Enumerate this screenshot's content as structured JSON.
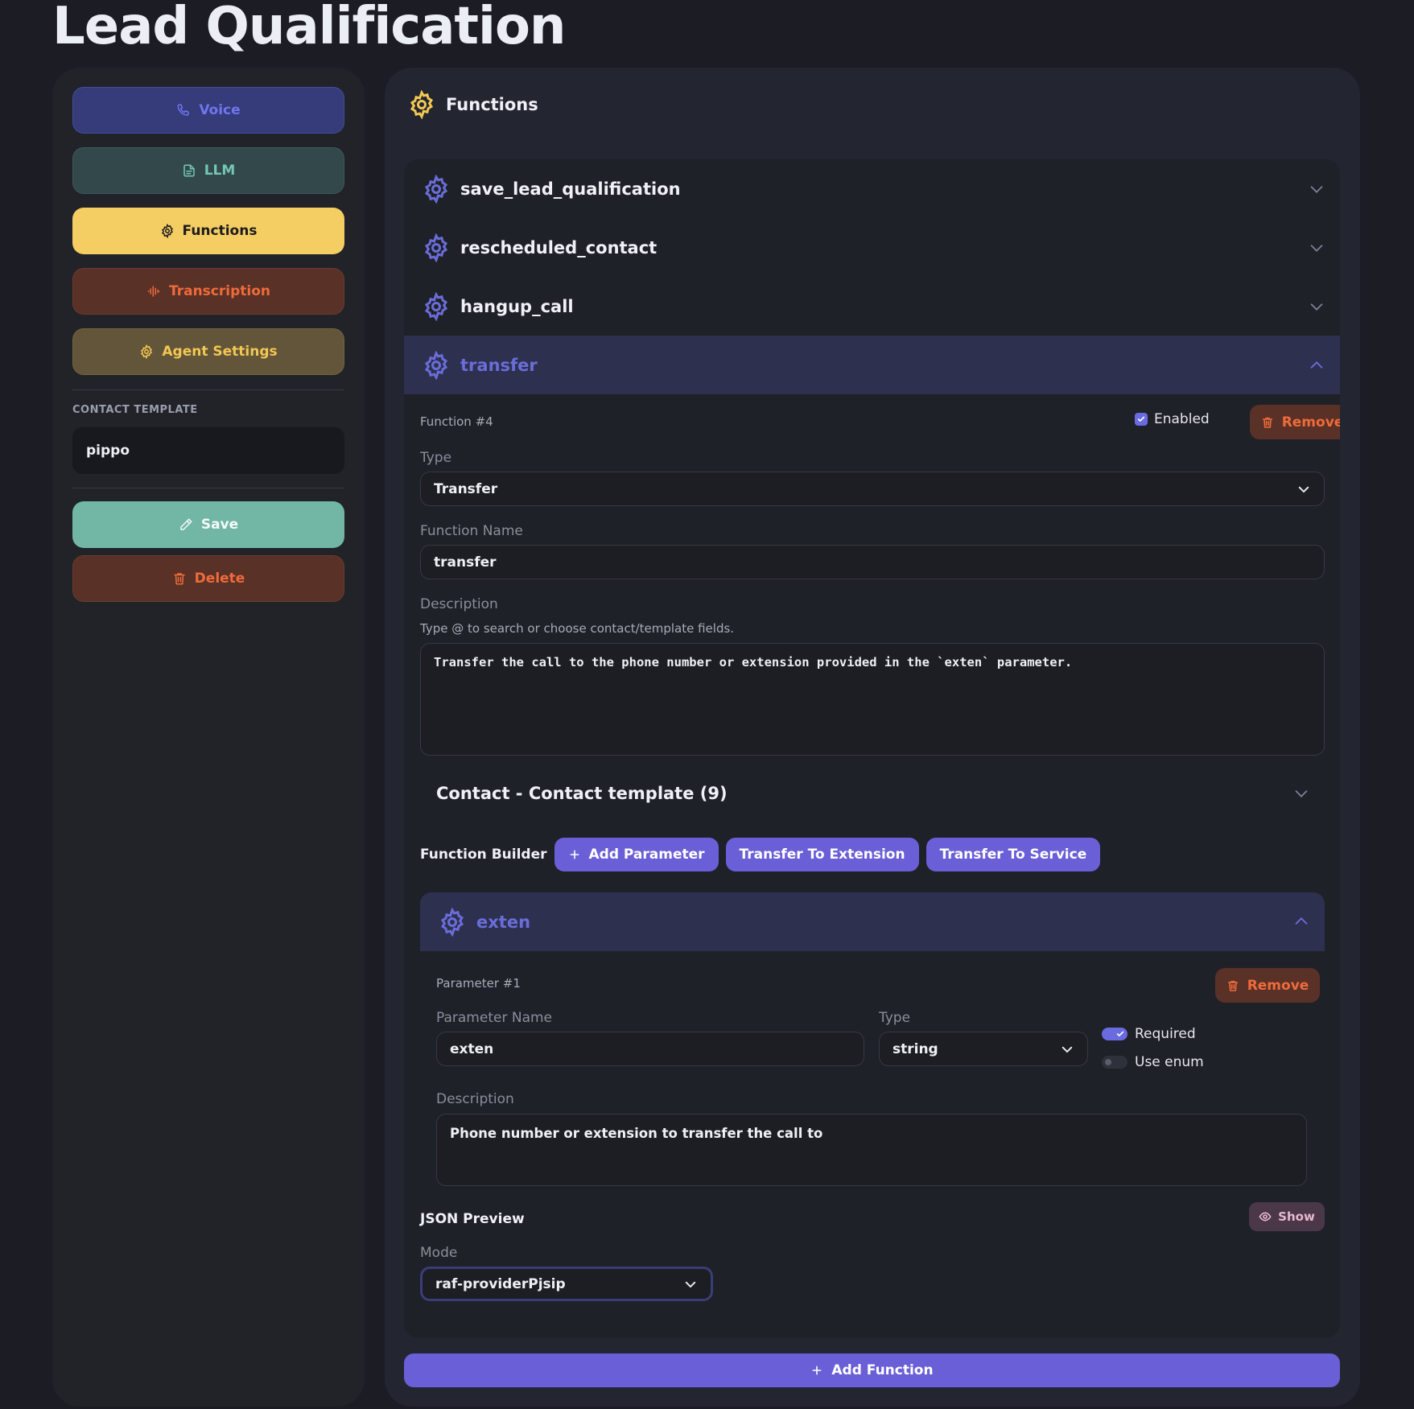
{
  "page": {
    "title": "Lead Qualification"
  },
  "sidebar": {
    "nav": {
      "voice": "Voice",
      "llm": "LLM",
      "functions": "Functions",
      "transcription": "Transcription",
      "agent_settings": "Agent Settings"
    },
    "contact_template_label": "CONTACT TEMPLATE",
    "contact_template_value": "pippo",
    "save_label": "Save",
    "delete_label": "Delete"
  },
  "main": {
    "header": "Functions",
    "functions": [
      {
        "name": "save_lead_qualification",
        "expanded": false
      },
      {
        "name": "rescheduled_contact",
        "expanded": false
      },
      {
        "name": "hangup_call",
        "expanded": false
      },
      {
        "name": "transfer",
        "expanded": true
      }
    ],
    "detail": {
      "number_label": "Function #4",
      "enabled_label": "Enabled",
      "enabled": true,
      "remove_label": "Remove",
      "type_label": "Type",
      "type_value": "Transfer",
      "name_label": "Function Name",
      "name_value": "transfer",
      "description_label": "Description",
      "description_hint": "Type @ to search or choose contact/template fields.",
      "description_value": "Transfer the call to the phone number or extension provided in the `exten` parameter.",
      "contact_section": "Contact - Contact template (9)",
      "builder_label": "Function Builder",
      "add_parameter_label": "Add Parameter",
      "transfer_extension_label": "Transfer To Extension",
      "transfer_service_label": "Transfer To Service",
      "parameter": {
        "header": "exten",
        "number_label": "Parameter #1",
        "remove_label": "Remove",
        "name_label": "Parameter Name",
        "name_value": "exten",
        "type_label": "Type",
        "type_value": "string",
        "required_label": "Required",
        "required": true,
        "use_enum_label": "Use enum",
        "use_enum": false,
        "description_label": "Description",
        "description_value": "Phone number or extension to transfer the call to"
      },
      "json_preview_label": "JSON Preview",
      "show_label": "Show",
      "mode_label": "Mode",
      "mode_value": "raf-providerPjsip"
    },
    "add_function_label": "Add Function"
  },
  "colors": {
    "accent_purple": "#6a5fd6",
    "functions_yellow": "#f4cd63",
    "remove_orange": "#ee6b3c",
    "save_teal": "#72b6a6"
  }
}
